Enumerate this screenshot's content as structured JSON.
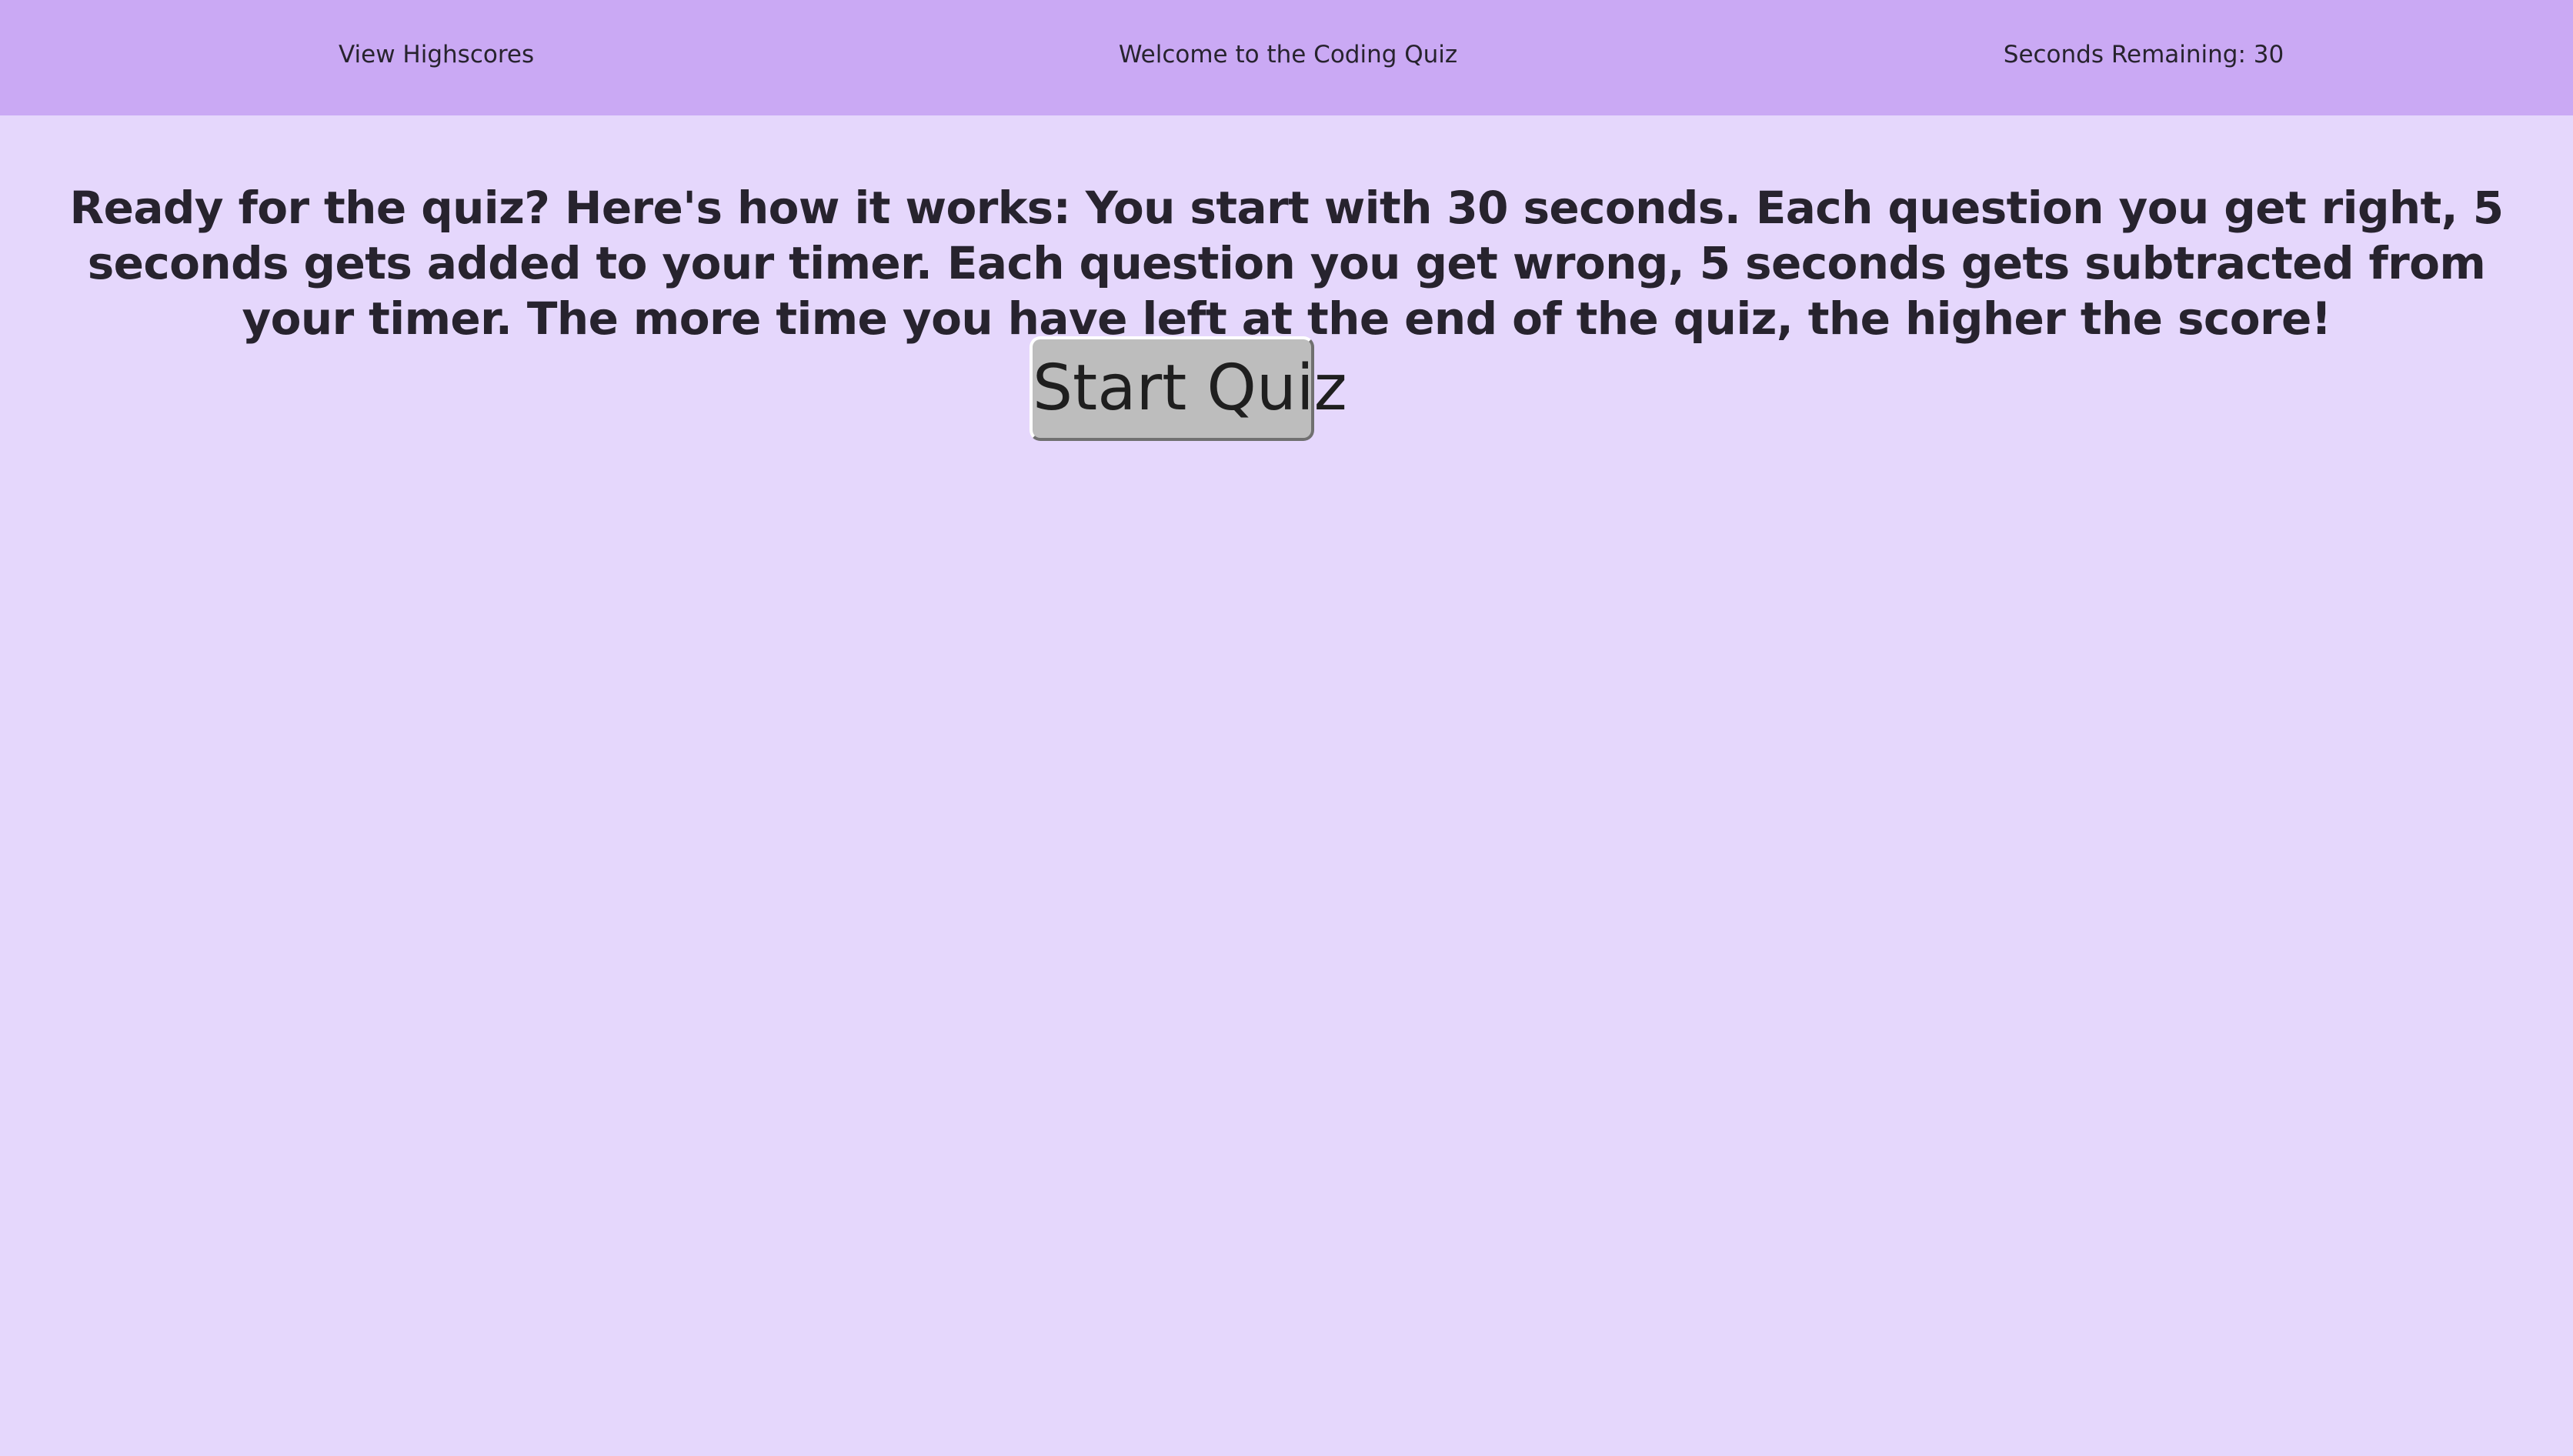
{
  "header": {
    "highscores_link": "View Highscores",
    "title": "Welcome to the Coding Quiz",
    "timer_text": "Seconds Remaining: 30"
  },
  "main": {
    "intro_text": "Ready for the quiz? Here's how it works: You start with 30 seconds. Each question you get right, 5 seconds gets added to your timer. Each question you get wrong, 5 seconds gets subtracted from your timer. The more time you have left at the end of the quiz, the higher the score!",
    "start_button_label": "Start Quiz"
  },
  "colors": {
    "page_background": "#e5d7fc",
    "header_background": "#caa9f4",
    "button_background": "#bdbdbd",
    "text": "#27232e"
  }
}
